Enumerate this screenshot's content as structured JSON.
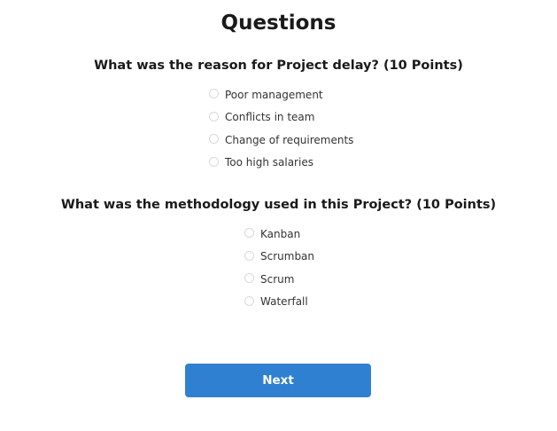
{
  "page": {
    "title": "Questions"
  },
  "questions": [
    {
      "text": "What was the reason for Project delay? (10 Points)",
      "options": [
        "Poor management",
        "Conflicts in team",
        "Change of requirements",
        "Too high salaries"
      ]
    },
    {
      "text": "What was the methodology used in this Project? (10 Points)",
      "options": [
        "Kanban",
        "Scrumban",
        "Scrum",
        "Waterfall"
      ]
    }
  ],
  "footer": {
    "next_label": "Next"
  },
  "colors": {
    "accent": "#2f80d1",
    "radio_border": "#d9d9d9"
  }
}
